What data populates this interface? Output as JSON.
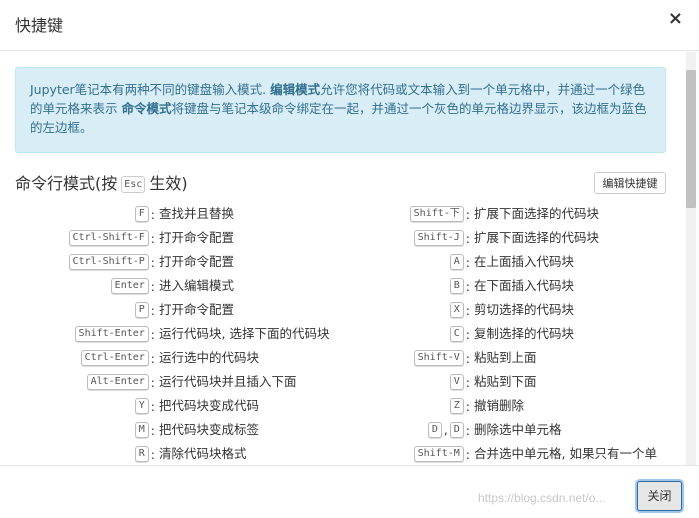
{
  "dialog": {
    "title": "快捷键",
    "close_icon": "×",
    "info_p1": "Jupyter笔记本有两种不同的键盘输入模式. ",
    "info_edit_mode": "编辑模式",
    "info_p2": "允许您将代码或文本输入到一个单元格中，并通过一个绿色的单元格来表示 ",
    "info_cmd_mode": "命令模式",
    "info_p3": "将键盘与笔记本级命令绑定在一起，并通过一个灰色的单元格边界显示，该边框为蓝色的左边框。",
    "section_prefix": "命令行模式(按",
    "section_key": "Esc",
    "section_suffix": "生效)",
    "edit_shortcuts_button": "编辑快捷键",
    "close_button": "关闭",
    "watermark": "https://blog.csdn.net/o..."
  },
  "left_shortcuts": [
    {
      "keys": [
        "F"
      ],
      "desc": "查找并且替换"
    },
    {
      "keys": [
        "Ctrl-Shift-F"
      ],
      "desc": "打开命令配置"
    },
    {
      "keys": [
        "Ctrl-Shift-P"
      ],
      "desc": "打开命令配置"
    },
    {
      "keys": [
        "Enter"
      ],
      "desc": "进入编辑模式"
    },
    {
      "keys": [
        "P"
      ],
      "desc": "打开命令配置"
    },
    {
      "keys": [
        "Shift-Enter"
      ],
      "desc": "运行代码块, 选择下面的代码块"
    },
    {
      "keys": [
        "Ctrl-Enter"
      ],
      "desc": "运行选中的代码块"
    },
    {
      "keys": [
        "Alt-Enter"
      ],
      "desc": "运行代码块并且插入下面"
    },
    {
      "keys": [
        "Y"
      ],
      "desc": "把代码块变成代码"
    },
    {
      "keys": [
        "M"
      ],
      "desc": "把代码块变成标签"
    },
    {
      "keys": [
        "R"
      ],
      "desc": "清除代码块格式"
    }
  ],
  "right_shortcuts": [
    {
      "keys": [
        "Shift-下"
      ],
      "desc": "扩展下面选择的代码块"
    },
    {
      "keys": [
        "Shift-J"
      ],
      "desc": "扩展下面选择的代码块"
    },
    {
      "keys": [
        "A"
      ],
      "desc": "在上面插入代码块"
    },
    {
      "keys": [
        "B"
      ],
      "desc": "在下面插入代码块"
    },
    {
      "keys": [
        "X"
      ],
      "desc": "剪切选择的代码块"
    },
    {
      "keys": [
        "C"
      ],
      "desc": "复制选择的代码块"
    },
    {
      "keys": [
        "Shift-V"
      ],
      "desc": "粘贴到上面"
    },
    {
      "keys": [
        "V"
      ],
      "desc": "粘贴到下面"
    },
    {
      "keys": [
        "Z"
      ],
      "desc": "撤销删除"
    },
    {
      "keys": [
        "D",
        "D"
      ],
      "desc": "删除选中单元格"
    },
    {
      "keys": [
        "Shift-M"
      ],
      "desc": "合并选中单元格, 如果只有一个单"
    }
  ]
}
